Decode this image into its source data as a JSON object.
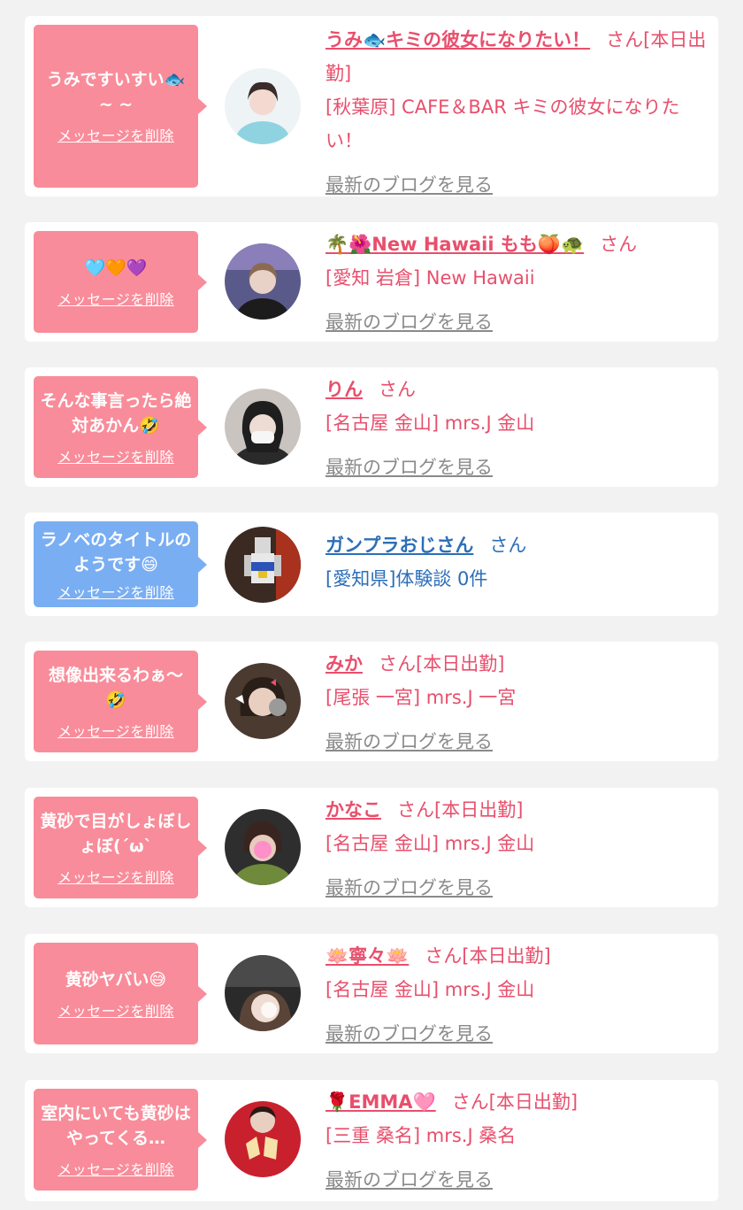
{
  "delete_label": "メッセージを削除",
  "blog_label": "最新のブログを見る",
  "colors": {
    "pink": "#f98c9a",
    "blue": "#79aef3",
    "name_pink": "#e84f6c",
    "name_blue": "#2c6eb8",
    "link_gray": "#8a8a8a"
  },
  "cards": [
    {
      "message": "うみですいすい🐟 ~ ~",
      "name": "うみ🐟キミの彼女になりたい！",
      "suffix": "さん[本日出勤]",
      "shop": "[秋葉原] CAFE＆BAR キミの彼女になりたい！",
      "blog": "最新のブログを見る",
      "theme": "pink",
      "avatar_icon": "profile-photo-woman-blue-dress"
    },
    {
      "message": "🩵🧡💜",
      "name": "🌴🌺New Hawaii もも🍑🐢",
      "suffix": "さん",
      "shop": "[愛知 岩倉] New Hawaii",
      "blog": "最新のブログを見る",
      "theme": "pink",
      "avatar_icon": "profile-photo-blurred-face"
    },
    {
      "message": "そんな事言ったら絶対あかん🤣",
      "name": "りん",
      "suffix": "さん",
      "shop": "[名古屋 金山] mrs.J 金山",
      "blog": "最新のブログを見る",
      "theme": "pink",
      "avatar_icon": "profile-photo-masked-face"
    },
    {
      "message": "ラノベのタイトルのようです😄",
      "name": "ガンプラおじさん",
      "suffix": "さん",
      "shop": "[愛知県]体験談 0件",
      "blog": "",
      "theme": "blue",
      "avatar_icon": "profile-photo-gundam-model"
    },
    {
      "message": "想像出来るわぁ〜🤣",
      "name": "みか",
      "suffix": "さん[本日出勤]",
      "shop": "[尾張 一宮] mrs.J 一宮",
      "blog": "最新のブログを見る",
      "theme": "pink",
      "avatar_icon": "profile-photo-stickered-face"
    },
    {
      "message": "黄砂で目がしょぼしょぼ(´ω`",
      "name": "かなこ",
      "suffix": "さん[本日出勤]",
      "shop": "[名古屋 金山] mrs.J 金山",
      "blog": "最新のブログを見る",
      "theme": "pink",
      "avatar_icon": "profile-photo-pink-blur-face"
    },
    {
      "message": "黄砂ヤバい😅",
      "name": "🪷寧々🪷",
      "suffix": "さん[本日出勤]",
      "shop": "[名古屋 金山] mrs.J 金山",
      "blog": "最新のブログを見る",
      "theme": "pink",
      "avatar_icon": "profile-photo-dark-car"
    },
    {
      "message": "室内にいても黄砂はやってくる…",
      "name": "🌹EMMA🩷",
      "suffix": "さん[本日出勤]",
      "shop": "[三重 桑名] mrs.J 桑名",
      "blog": "最新のブログを見る",
      "theme": "pink",
      "avatar_icon": "profile-photo-red-sweater"
    }
  ]
}
